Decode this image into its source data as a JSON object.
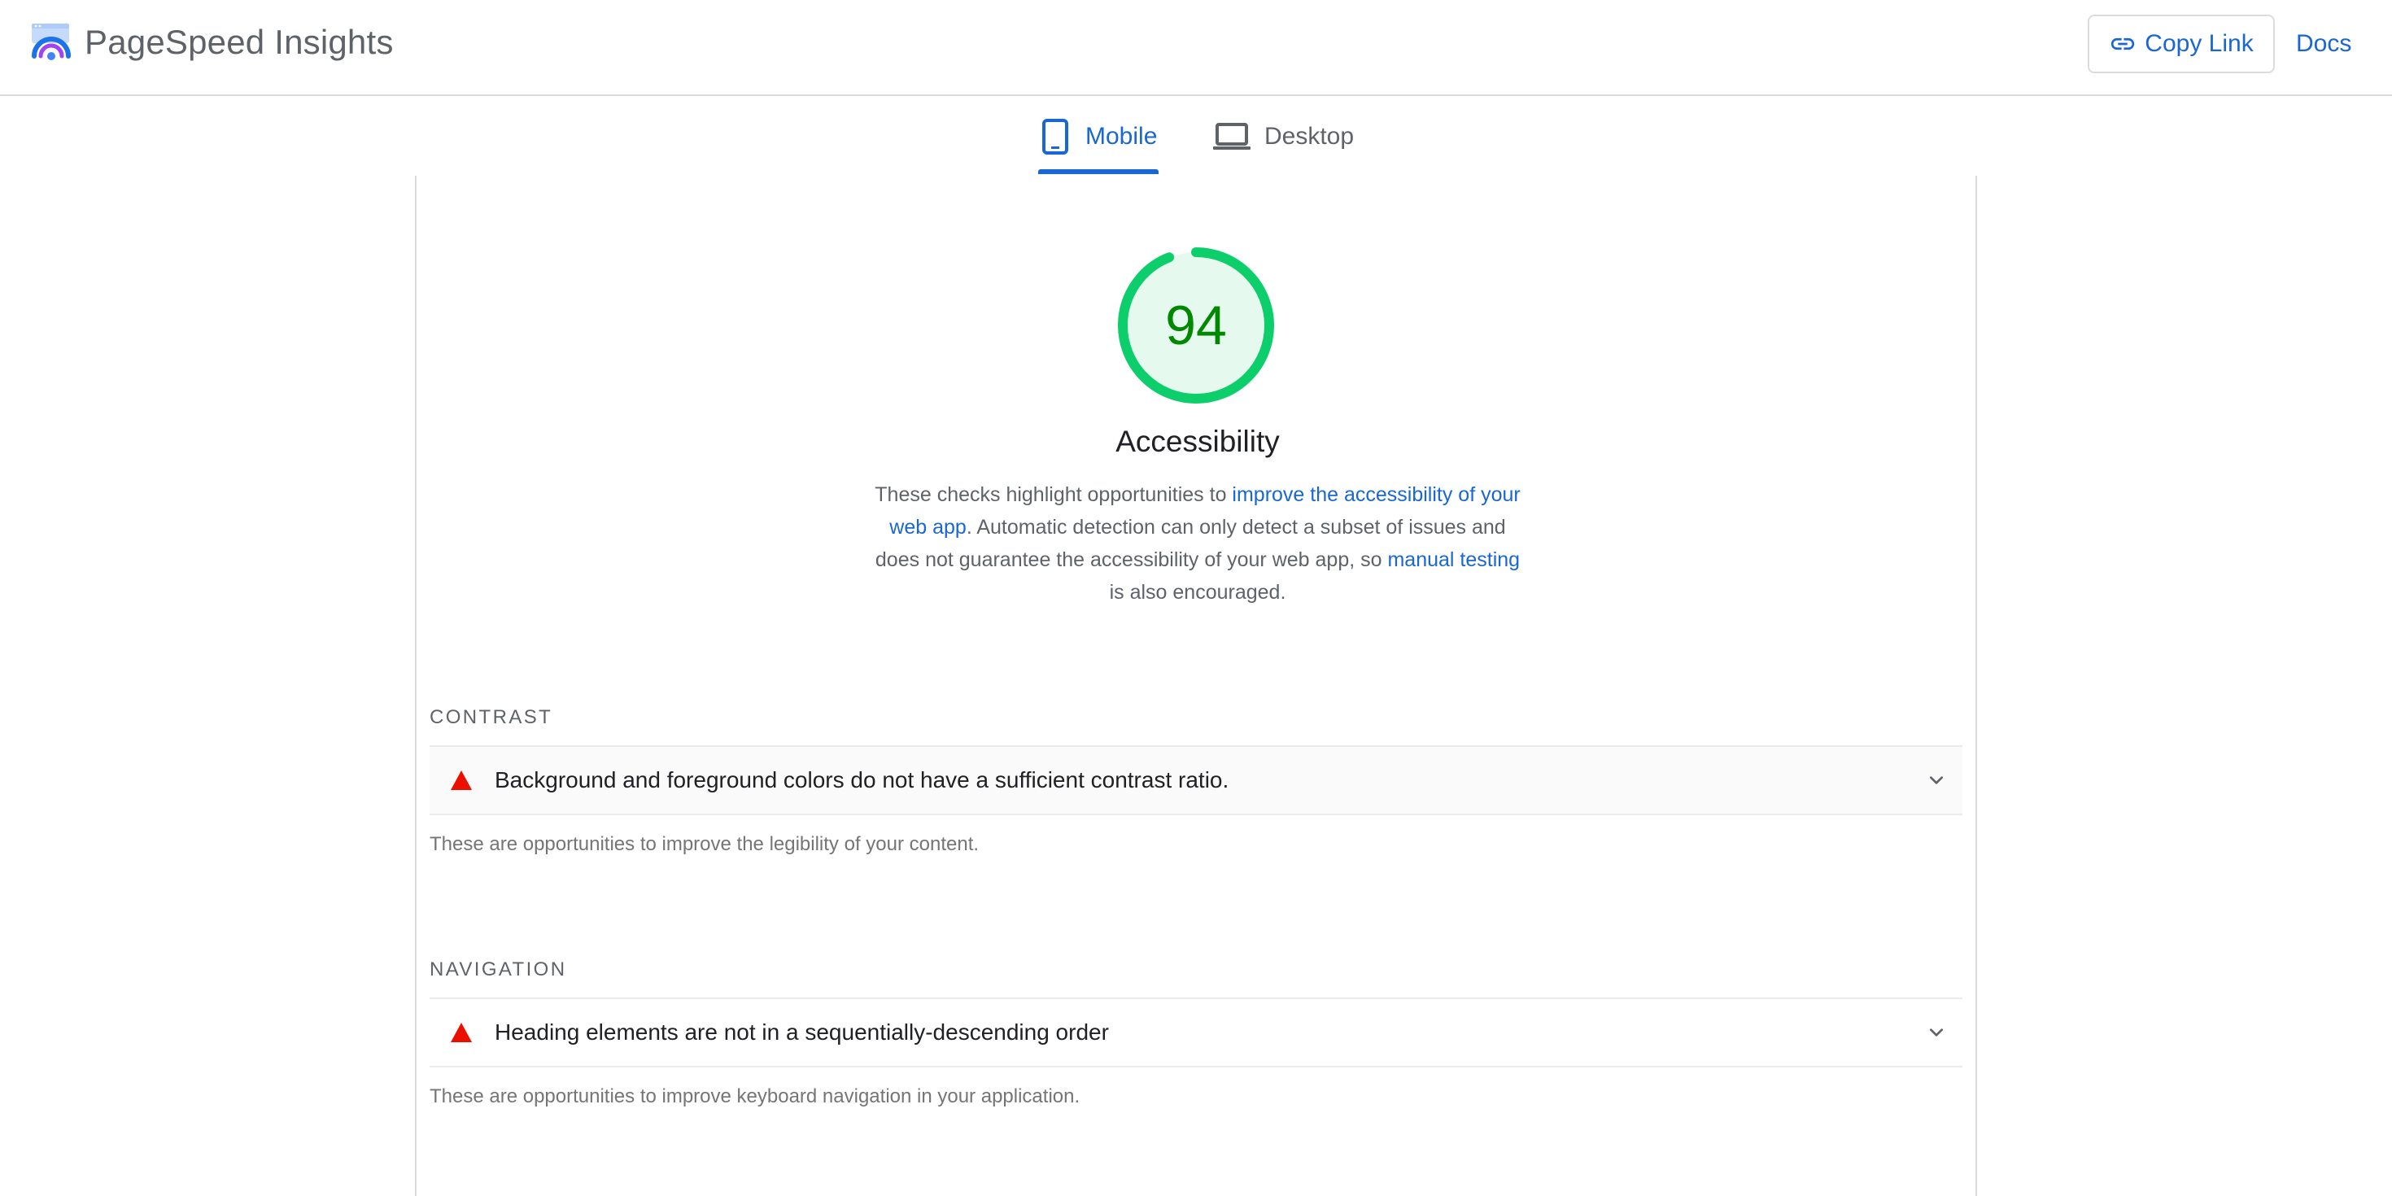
{
  "header": {
    "title": "PageSpeed Insights",
    "logo_icon": "pagespeed-logo-icon",
    "copy_link_label": "Copy Link",
    "copy_link_icon": "link-icon",
    "docs_label": "Docs"
  },
  "tabs": [
    {
      "label": "Mobile",
      "icon": "mobile-phone-icon",
      "selected": true
    },
    {
      "label": "Desktop",
      "icon": "laptop-icon",
      "selected": false
    }
  ],
  "category": {
    "score": "94",
    "score_value": 94,
    "title": "Accessibility",
    "description": {
      "part1": "These checks highlight opportunities to ",
      "link1": "improve the accessibility of your web app",
      "part2": ". Automatic detection can only detect a subset of issues and does not guarantee the accessibility of your web app, so ",
      "link2": "manual testing",
      "part3": " is also encouraged."
    }
  },
  "groups": [
    {
      "title": "CONTRAST",
      "audits": [
        {
          "title": "Background and foreground colors do not have a sufficient contrast ratio.",
          "status": "fail"
        }
      ],
      "description": "These are opportunities to improve the legibility of your content."
    },
    {
      "title": "NAVIGATION",
      "audits": [
        {
          "title": "Heading elements are not in a sequentially-descending order",
          "status": "fail"
        }
      ],
      "description": "These are opportunities to improve keyboard navigation in your application."
    }
  ],
  "colors": {
    "accent": "#1967d2",
    "pass": "#0cce6b",
    "pass_text": "#008800",
    "pass_fill": "#e6f9ee",
    "fail": "#eb0f00",
    "border": "#dadce0"
  }
}
